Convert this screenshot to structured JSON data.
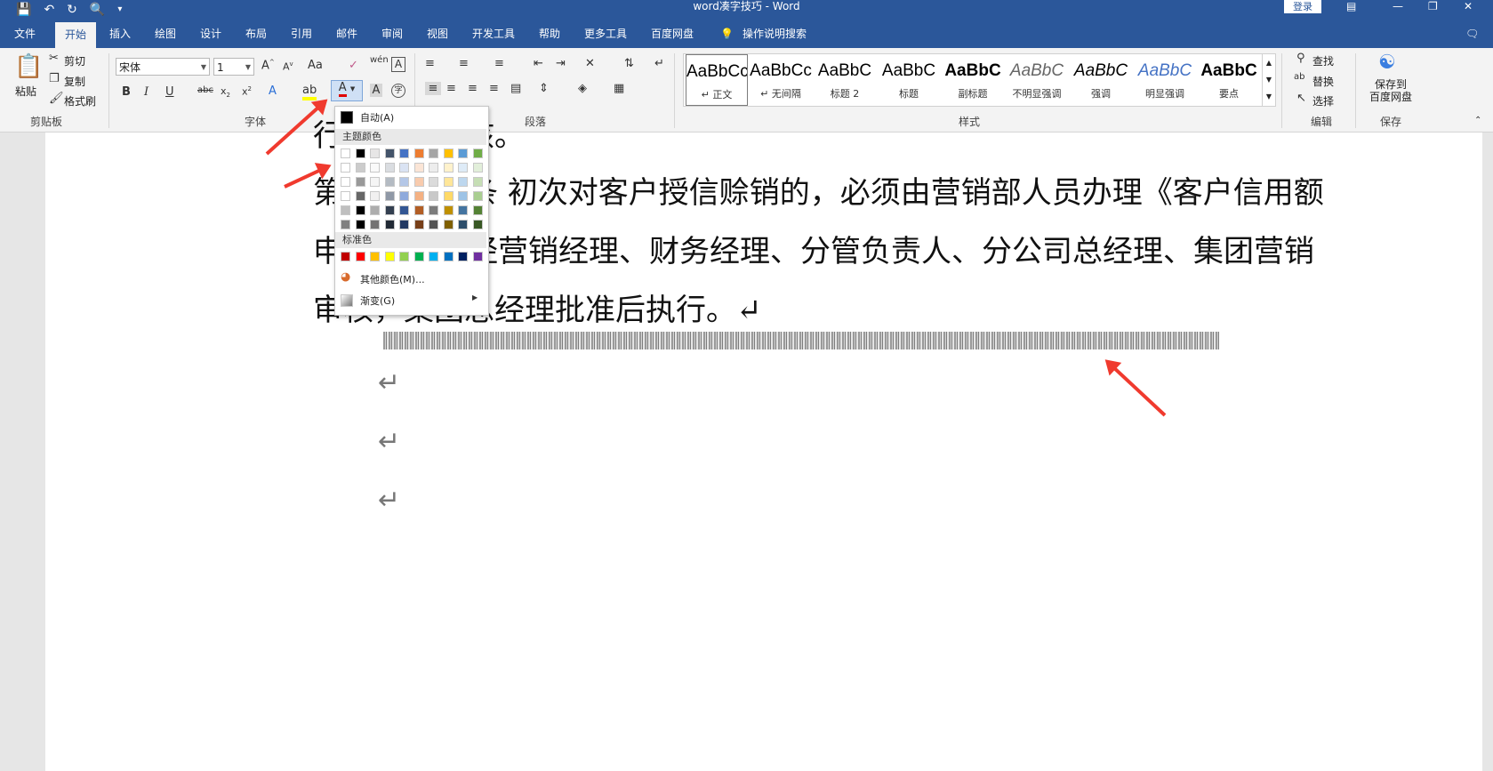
{
  "window": {
    "title": "word凑字技巧 - Word",
    "login_label": "登录",
    "qat_icons": [
      "save-icon",
      "undo-icon",
      "redo-icon",
      "print-preview-icon",
      "customize-icon"
    ]
  },
  "tabs": [
    "文件",
    "开始",
    "插入",
    "绘图",
    "设计",
    "布局",
    "引用",
    "邮件",
    "审阅",
    "视图",
    "开发工具",
    "帮助",
    "更多工具",
    "百度网盘",
    "操作说明搜索"
  ],
  "active_tab": "开始",
  "clipboard": {
    "paste": "粘贴",
    "cut": "剪切",
    "copy": "复制",
    "format_painter": "格式刷",
    "group": "剪贴板"
  },
  "font": {
    "name": "宋体",
    "size": "1",
    "group": "字体"
  },
  "paragraph": {
    "group": "段落"
  },
  "styles": {
    "group": "样式",
    "items": [
      {
        "preview": "AaBbCc",
        "name": "↵ 正文"
      },
      {
        "preview": "AaBbCc",
        "name": "↵ 无间隔"
      },
      {
        "preview": "AaBbC",
        "name": "标题 2"
      },
      {
        "preview": "AaBbC",
        "name": "标题"
      },
      {
        "preview": "AaBbC",
        "name": "副标题"
      },
      {
        "preview": "AaBbC",
        "name": "不明显强调"
      },
      {
        "preview": "AaBbC",
        "name": "强调"
      },
      {
        "preview": "AaBbC",
        "name": "明显强调"
      },
      {
        "preview": "AaBbC",
        "name": "要点"
      }
    ]
  },
  "editing": {
    "find": "查找",
    "replace": "替换",
    "select": "选择",
    "group": "编辑"
  },
  "save": {
    "label": "保存到\n百度网盘",
    "group": "保存"
  },
  "color_menu": {
    "auto": "自动(A)",
    "theme_header": "主题颜色",
    "standard_header": "标准色",
    "more_colors": "其他颜色(M)...",
    "gradient": "渐变(G)",
    "theme_top": [
      "#ffffff",
      "#000000",
      "#e7e6e6",
      "#44546a",
      "#4472c4",
      "#ed7d31",
      "#a5a5a5",
      "#ffc000",
      "#5b9bd5",
      "#70ad47"
    ],
    "standard": [
      "#c00000",
      "#ff0000",
      "#ffc000",
      "#ffff00",
      "#92d050",
      "#00b050",
      "#00b0f0",
      "#0070c0",
      "#002060",
      "#7030a0"
    ]
  },
  "document": {
    "line0": "↵",
    "line1": "条 初次对客户授信赊销的，必须由营销部人员办理《客户信用额",
    "line2": "经营销经理、财务经理、分管负责人、分公司总经理、集团营销",
    "line3": "审核，集团总经理批准后执行。↵",
    "line0_text": "行调查、考核。",
    "line2_start": "申",
    "line1_start": "第",
    "pilcrow": "↵"
  },
  "colors": {
    "accent": "#2b579a",
    "arrow": "#f03a2e"
  }
}
